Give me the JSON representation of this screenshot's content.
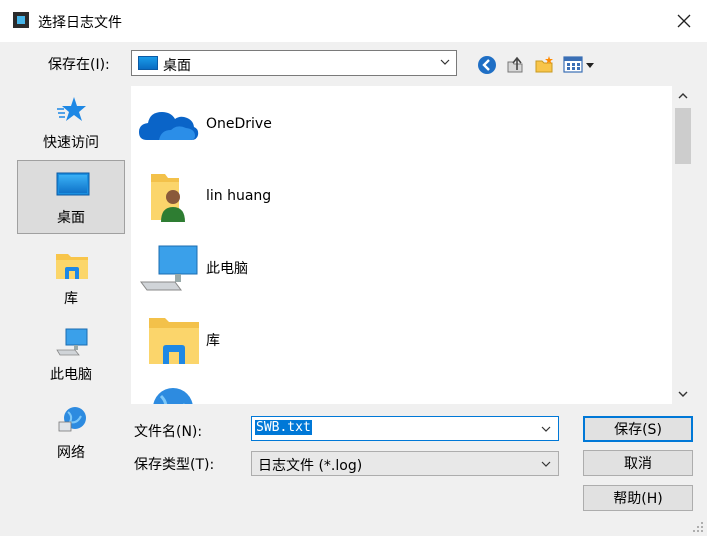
{
  "window": {
    "title": "选择日志文件"
  },
  "toolbar": {
    "look_in_label": "保存在(I):",
    "look_in_value": "桌面"
  },
  "places": [
    {
      "label": "快速访问",
      "icon": "star-icon"
    },
    {
      "label": "桌面",
      "icon": "desktop-icon",
      "selected": true
    },
    {
      "label": "库",
      "icon": "library-icon"
    },
    {
      "label": "此电脑",
      "icon": "computer-icon"
    },
    {
      "label": "网络",
      "icon": "network-icon"
    }
  ],
  "files": [
    {
      "name": "OneDrive",
      "icon": "cloud-icon"
    },
    {
      "name": "lin huang",
      "icon": "user-folder-icon"
    },
    {
      "name": "此电脑",
      "icon": "computer-icon"
    },
    {
      "name": "库",
      "icon": "library-icon"
    }
  ],
  "fields": {
    "filename_label": "文件名(N):",
    "filename_value": "SWB.txt",
    "filetype_label": "保存类型(T):",
    "filetype_value": "日志文件 (*.log)"
  },
  "buttons": {
    "save": "保存(S)",
    "cancel": "取消",
    "help": "帮助(H)"
  },
  "colors": {
    "accent": "#0078d7",
    "folder": "#f8c54a",
    "cloud": "#0a64c8"
  }
}
